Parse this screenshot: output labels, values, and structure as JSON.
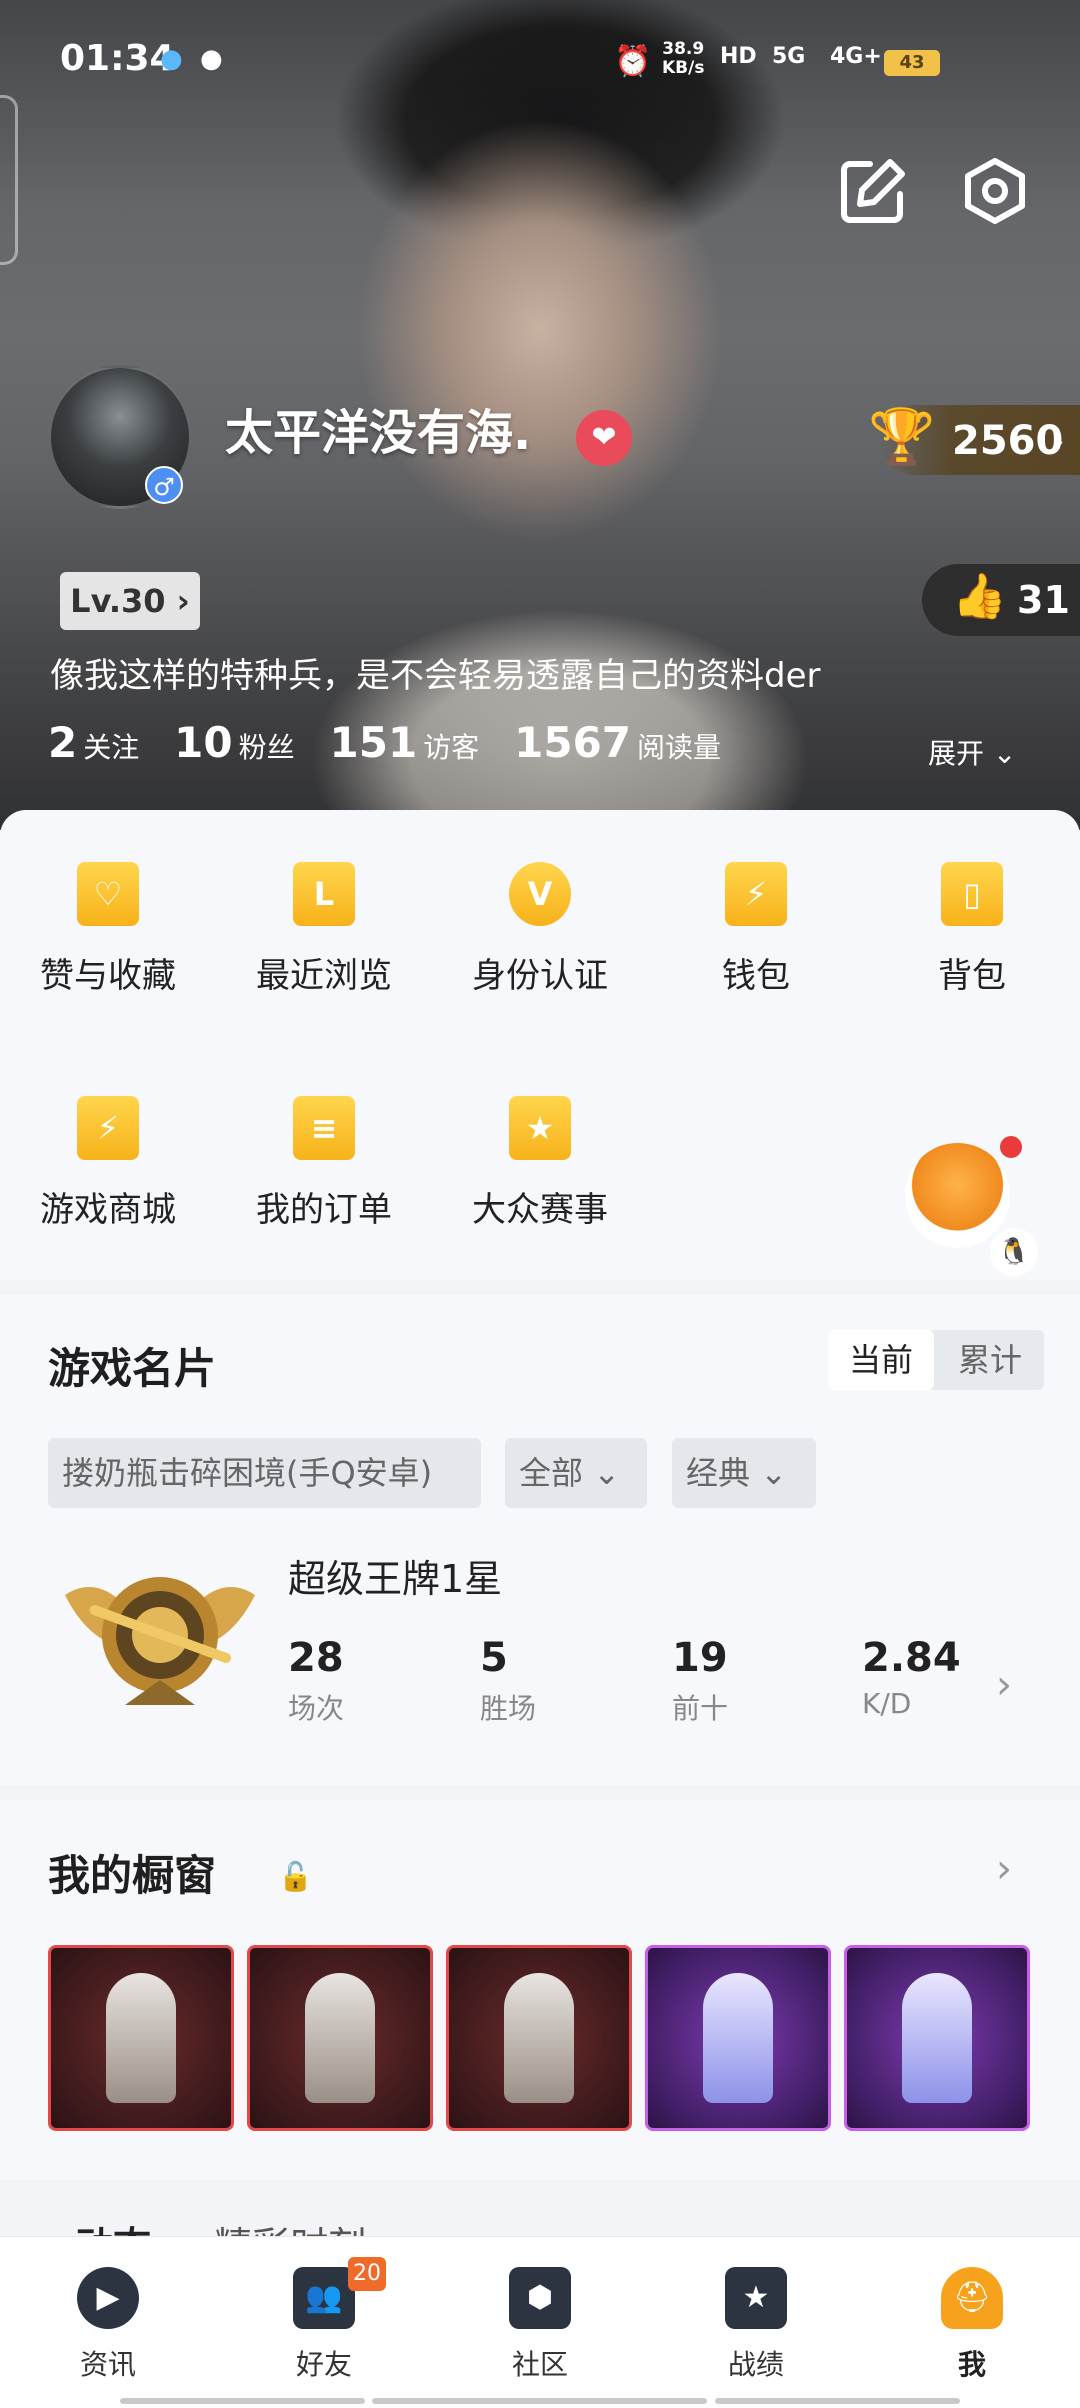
{
  "status_bar": {
    "time": "01:34",
    "net_speed": "38.9",
    "net_unit": "KB/s",
    "hd": "HD",
    "net_5g": "5G",
    "net_4g": "4G+",
    "battery": "43"
  },
  "profile": {
    "nickname": "太平洋没有海.",
    "trophy": "2560",
    "level": "Lv.30",
    "likes": "31",
    "bio": "像我这样的特种兵，是不会轻易透露自己的资料der",
    "stats": [
      {
        "value": "2",
        "label": "关注"
      },
      {
        "value": "10",
        "label": "粉丝"
      },
      {
        "value": "151",
        "label": "访客"
      },
      {
        "value": "1567",
        "label": "阅读量"
      }
    ],
    "expand": "展开"
  },
  "grid": [
    {
      "label": "赞与收藏",
      "icon": "favorite-icon"
    },
    {
      "label": "最近浏览",
      "icon": "history-icon"
    },
    {
      "label": "身份认证",
      "icon": "verify-icon"
    },
    {
      "label": "钱包",
      "icon": "wallet-icon"
    },
    {
      "label": "背包",
      "icon": "backpack-icon"
    },
    {
      "label": "游戏商城",
      "icon": "shop-icon"
    },
    {
      "label": "我的订单",
      "icon": "orders-icon"
    },
    {
      "label": "大众赛事",
      "icon": "tournament-icon"
    }
  ],
  "game_card": {
    "title": "游戏名片",
    "toggle_current": "当前",
    "toggle_total": "累计",
    "chips": [
      "搂奶瓶击碎困境(手Q安卓)",
      "全部",
      "经典"
    ],
    "rank_name": "超级王牌1星",
    "metrics": [
      {
        "value": "28",
        "label": "场次"
      },
      {
        "value": "5",
        "label": "胜场"
      },
      {
        "value": "19",
        "label": "前十"
      },
      {
        "value": "2.84",
        "label": "K/D"
      }
    ]
  },
  "showcase": {
    "title": "我的橱窗"
  },
  "feed": {
    "tabs": [
      "动态",
      "精彩时刻"
    ]
  },
  "nav": {
    "items": [
      {
        "label": "资讯"
      },
      {
        "label": "好友",
        "badge": "20"
      },
      {
        "label": "社区"
      },
      {
        "label": "战绩"
      },
      {
        "label": "我"
      }
    ]
  },
  "colors": {
    "accent": "#f6a21c",
    "heart": "#ea4b5b",
    "gender": "#4d8ff2"
  }
}
